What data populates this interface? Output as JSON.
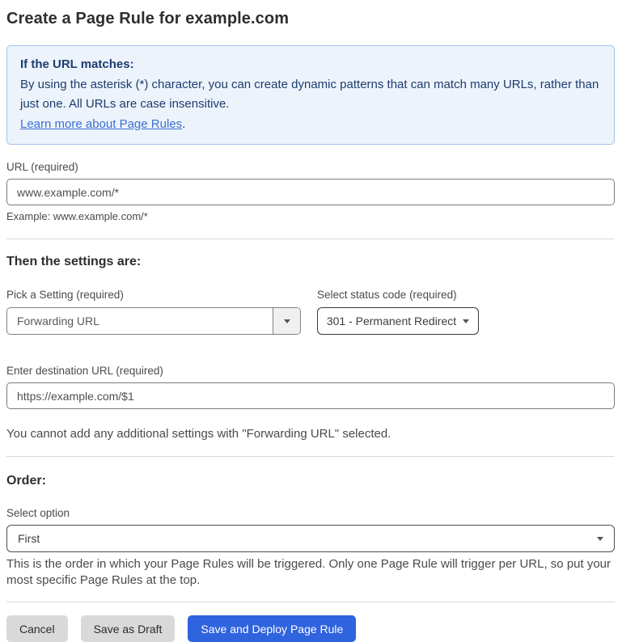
{
  "page": {
    "title": "Create a Page Rule for example.com"
  },
  "info_box": {
    "heading": "If the URL matches:",
    "body": "By using the asterisk (*) character, you can create dynamic patterns that can match many URLs, rather than just one. All URLs are case insensitive.",
    "link_label": "Learn more about Page Rules",
    "link_suffix": "."
  },
  "url_field": {
    "label": "URL (required)",
    "value": "www.example.com/*",
    "helper": "Example: www.example.com/*"
  },
  "settings_section": {
    "heading": "Then the settings are:",
    "setting_select": {
      "label": "Pick a Setting (required)",
      "value": "Forwarding URL"
    },
    "status_select": {
      "label": "Select status code (required)",
      "value": "301 - Permanent Redirect"
    },
    "destination_field": {
      "label": "Enter destination URL (required)",
      "value": "https://example.com/$1"
    },
    "note": "You cannot add any additional settings with \"Forwarding URL\" selected."
  },
  "order_section": {
    "heading": "Order:",
    "select_label": "Select option",
    "selected_option": "First",
    "helper": "This is the order in which your Page Rules will be triggered. Only one Page Rule will trigger per URL, so put your most specific Page Rules at the top."
  },
  "footer": {
    "cancel_label": "Cancel",
    "save_draft_label": "Save as Draft",
    "save_deploy_label": "Save and Deploy Page Rule"
  },
  "colors": {
    "accent_blue": "#3063de",
    "button_gray": "#d9d9d9",
    "info_background": "#ecf3fb",
    "info_border": "#a5c3ea",
    "info_text": "#1d3c6e",
    "link_blue": "#3b6fd1"
  }
}
